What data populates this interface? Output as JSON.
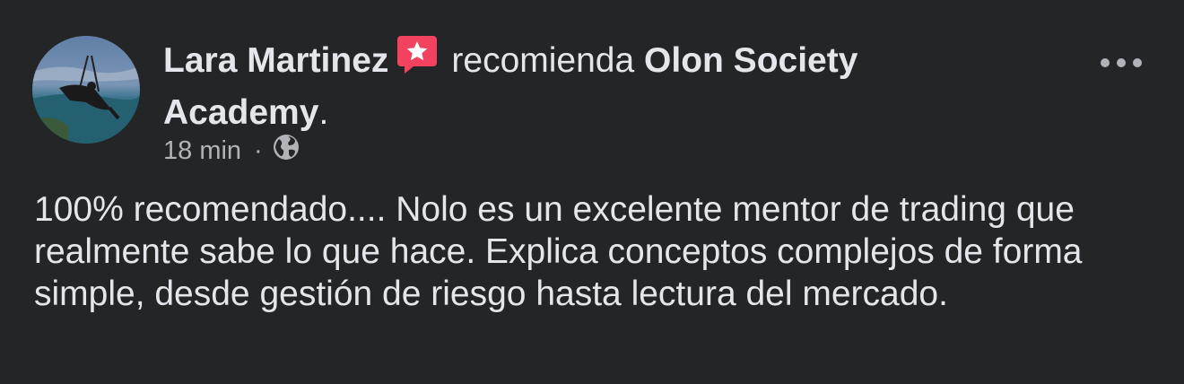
{
  "post": {
    "author": "Lara Martinez",
    "action": "recomienda",
    "page_name": "Olon Society Academy",
    "page_name_suffix": ".",
    "timestamp": "18 min",
    "separator": "·",
    "privacy_icon": "globe-icon",
    "badge_icon": "recommend-star-icon",
    "more_icon": "more-options-icon",
    "body": "100% recomendado.... Nolo es un excelente mentor de trading que realmente sabe lo que hace. Explica conceptos complejos de forma simple, desde gestión de riesgo hasta lectura del mercado."
  },
  "colors": {
    "background": "#242526",
    "primary_text": "#e4e6eb",
    "secondary_text": "#b0b3b8",
    "badge": "#f3425f"
  }
}
